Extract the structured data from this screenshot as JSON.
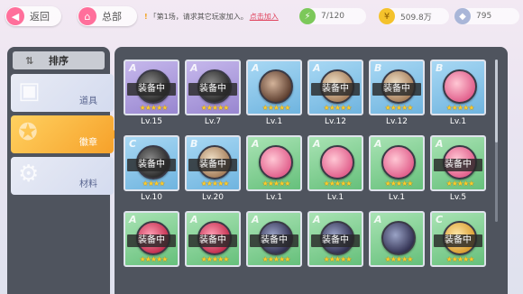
{
  "topbar": {
    "back_label": "返回",
    "home_label": "总部",
    "notice_prefix": "「第1场，请求其它玩家加入。",
    "notice_link": "点击加入",
    "stamina": "7/120",
    "coins": "509.8万",
    "gems": "795"
  },
  "sidebar": {
    "sort_label": "排序",
    "categories": [
      {
        "label": "道具",
        "icon": "gift-icon",
        "active": false
      },
      {
        "label": "徽章",
        "icon": "star-badge-icon",
        "active": true
      },
      {
        "label": "材料",
        "icon": "gear-icon",
        "active": false
      }
    ]
  },
  "equip_label": "装备中",
  "badges": [
    {
      "rank": "A",
      "bg": "purple",
      "tone": "bw",
      "equipped": true,
      "stars": 5,
      "level": "Lv.15"
    },
    {
      "rank": "A",
      "bg": "purple",
      "tone": "bw",
      "equipped": true,
      "stars": 5,
      "level": "Lv.7"
    },
    {
      "rank": "A",
      "bg": "blue",
      "tone": "brown",
      "equipped": false,
      "stars": 5,
      "level": "Lv.1"
    },
    {
      "rank": "A",
      "bg": "blue",
      "tone": "tan",
      "equipped": true,
      "stars": 5,
      "level": "Lv.12"
    },
    {
      "rank": "B",
      "bg": "blue",
      "tone": "tan",
      "equipped": true,
      "stars": 5,
      "level": "Lv.12"
    },
    {
      "rank": "B",
      "bg": "blue",
      "tone": "pink",
      "equipped": false,
      "stars": 5,
      "level": "Lv.1"
    },
    {
      "rank": "C",
      "bg": "blue",
      "tone": "bw",
      "equipped": true,
      "stars": 4,
      "level": "Lv.10"
    },
    {
      "rank": "B",
      "bg": "blue",
      "tone": "tan",
      "equipped": true,
      "stars": 5,
      "level": "Lv.20"
    },
    {
      "rank": "A",
      "bg": "green",
      "tone": "pink",
      "equipped": false,
      "stars": 5,
      "level": "Lv.1"
    },
    {
      "rank": "A",
      "bg": "green",
      "tone": "pink",
      "equipped": false,
      "stars": 5,
      "level": "Lv.1"
    },
    {
      "rank": "A",
      "bg": "green",
      "tone": "pink",
      "equipped": false,
      "stars": 5,
      "level": "Lv.1"
    },
    {
      "rank": "A",
      "bg": "green",
      "tone": "pink",
      "equipped": true,
      "stars": 5,
      "level": "Lv.5"
    },
    {
      "rank": "A",
      "bg": "green",
      "tone": "red",
      "equipped": true,
      "stars": 5,
      "level": ""
    },
    {
      "rank": "A",
      "bg": "green",
      "tone": "red",
      "equipped": true,
      "stars": 5,
      "level": ""
    },
    {
      "rank": "A",
      "bg": "green",
      "tone": "dark",
      "equipped": true,
      "stars": 5,
      "level": ""
    },
    {
      "rank": "A",
      "bg": "green",
      "tone": "dark",
      "equipped": true,
      "stars": 5,
      "level": ""
    },
    {
      "rank": "A",
      "bg": "green",
      "tone": "dark",
      "equipped": false,
      "stars": 5,
      "level": ""
    },
    {
      "rank": "C",
      "bg": "green",
      "tone": "gold",
      "equipped": true,
      "stars": 5,
      "level": ""
    }
  ]
}
